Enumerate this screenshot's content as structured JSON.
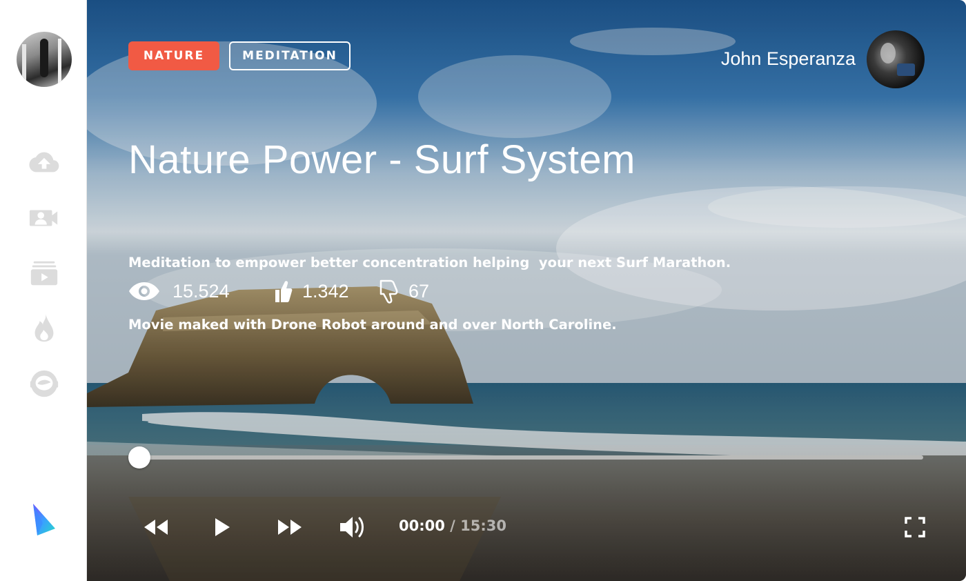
{
  "sidebar": {
    "avatar_icon": "profile-photo",
    "icons": [
      "cloud-upload-icon",
      "video-camera-icon",
      "playlist-icon",
      "fire-icon",
      "astronaut-icon"
    ],
    "icon_color": "#dcdcdc",
    "logo": "sail-logo"
  },
  "video": {
    "tags": [
      {
        "label": "NATURE",
        "style": "filled",
        "color": "#f15a44"
      },
      {
        "label": "MEDITATION",
        "style": "outline",
        "color": "#ffffff"
      }
    ],
    "author": {
      "name": "John Esperanza"
    },
    "title": "Nature Power - Surf System",
    "description": [
      "Meditation to empower better concentration helping  your next Surf Marathon.",
      "Movie maked with Drone Robot around and over North Caroline."
    ],
    "stats": {
      "views": "15.524",
      "likes": "1.342",
      "dislikes": "67"
    }
  },
  "player": {
    "progress": 0.0,
    "current_time": "00:00",
    "separator": "/",
    "total_time": "15:30",
    "controls": [
      "rewind-icon",
      "play-icon",
      "fast-forward-icon",
      "volume-icon",
      "fullscreen-icon"
    ]
  }
}
